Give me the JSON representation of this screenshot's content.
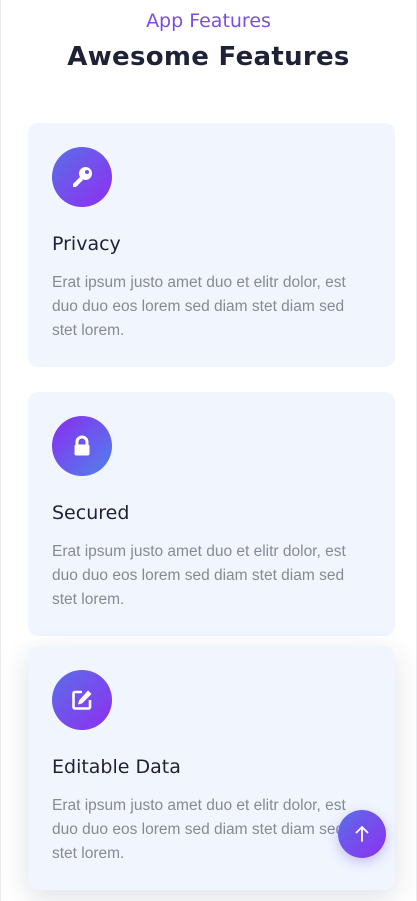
{
  "header": {
    "eyebrow": "App Features",
    "title": "Awesome Features"
  },
  "features": [
    {
      "title": "Privacy",
      "text": "Erat ipsum justo amet duo et elitr dolor, est duo duo eos lorem sed diam stet diam sed stet lorem.",
      "icon": "key-icon"
    },
    {
      "title": "Secured",
      "text": "Erat ipsum justo amet duo et elitr dolor, est duo duo eos lorem sed diam stet diam sed stet lorem.",
      "icon": "lock-icon"
    },
    {
      "title": "Editable Data",
      "text": "Erat ipsum justo amet duo et elitr dolor, est duo duo eos lorem sed diam stet diam sed stet lorem.",
      "icon": "edit-icon"
    }
  ],
  "scroll_top": {
    "icon": "arrow-up-icon"
  },
  "colors": {
    "accent": "#7b4de6",
    "heading": "#1f2236",
    "card_bg": "#f1f5fe",
    "body_text": "#858a93"
  }
}
